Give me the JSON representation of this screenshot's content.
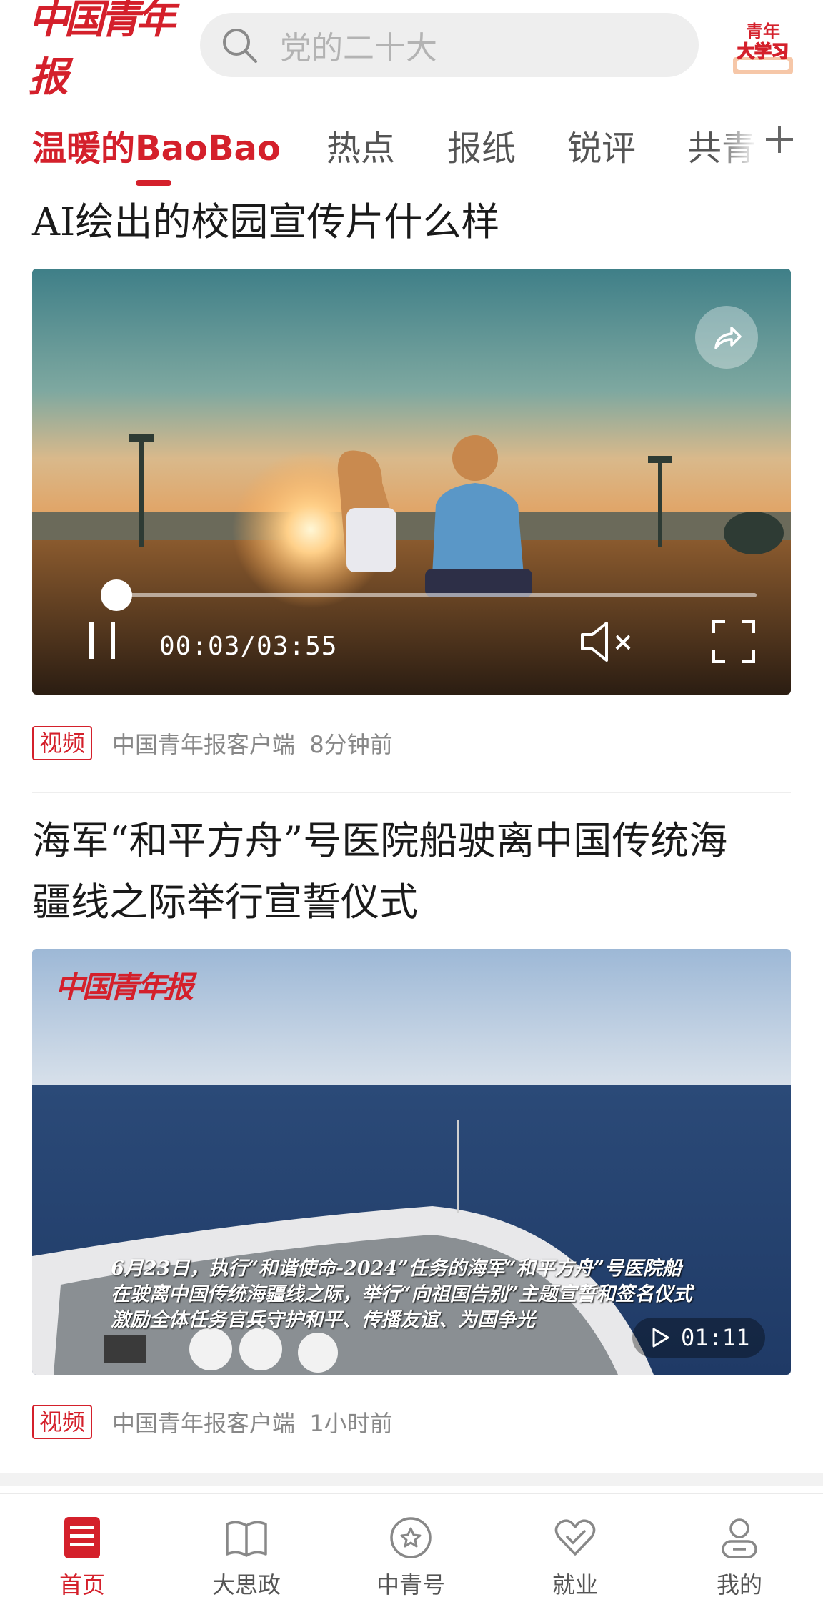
{
  "header": {
    "logo_text": "中国青年报",
    "search_placeholder": "党的二十大",
    "badge_line1": "青年",
    "badge_line2": "大学习"
  },
  "tabs": [
    {
      "label": "温暖的BaoBao",
      "active": true
    },
    {
      "label": "热点",
      "active": false
    },
    {
      "label": "报纸",
      "active": false
    },
    {
      "label": "锐评",
      "active": false
    },
    {
      "label": "共青",
      "active": false
    }
  ],
  "articles": [
    {
      "title": "AI绘出的校园宣传片什么样",
      "player": {
        "time": "00:03/03:55",
        "progress": 0.0128
      },
      "tag": "视频",
      "source": "中国青年报客户端",
      "time_ago": "8分钟前"
    },
    {
      "title_line1": "海军“和平方舟”号医院船驶离中国传统海",
      "title_line2": "疆线之际举行宣誓仪式",
      "watermark": "中国青年报",
      "caption_lines": [
        "6月23日，执行“和谐使命-2024”任务的海军“和平方舟”号医院船",
        "在驶离中国传统海疆线之际，举行“向祖国告别”主题宣誓和签名仪式",
        "激励全体任务官兵守护和平、传播友谊、为国争光"
      ],
      "duration": "01:11",
      "tag": "视频",
      "source": "中国青年报客户端",
      "time_ago": "1小时前"
    }
  ],
  "bottom_nav": [
    {
      "label": "首页",
      "icon": "home-doc-icon",
      "active": true
    },
    {
      "label": "大思政",
      "icon": "book-icon",
      "active": false
    },
    {
      "label": "中青号",
      "icon": "star-circle-icon",
      "active": false
    },
    {
      "label": "就业",
      "icon": "heart-check-icon",
      "active": false
    },
    {
      "label": "我的",
      "icon": "user-icon",
      "active": false
    }
  ],
  "colors": {
    "brand_red": "#d4202b",
    "muted_text": "#888888",
    "tab_text": "#555555"
  }
}
